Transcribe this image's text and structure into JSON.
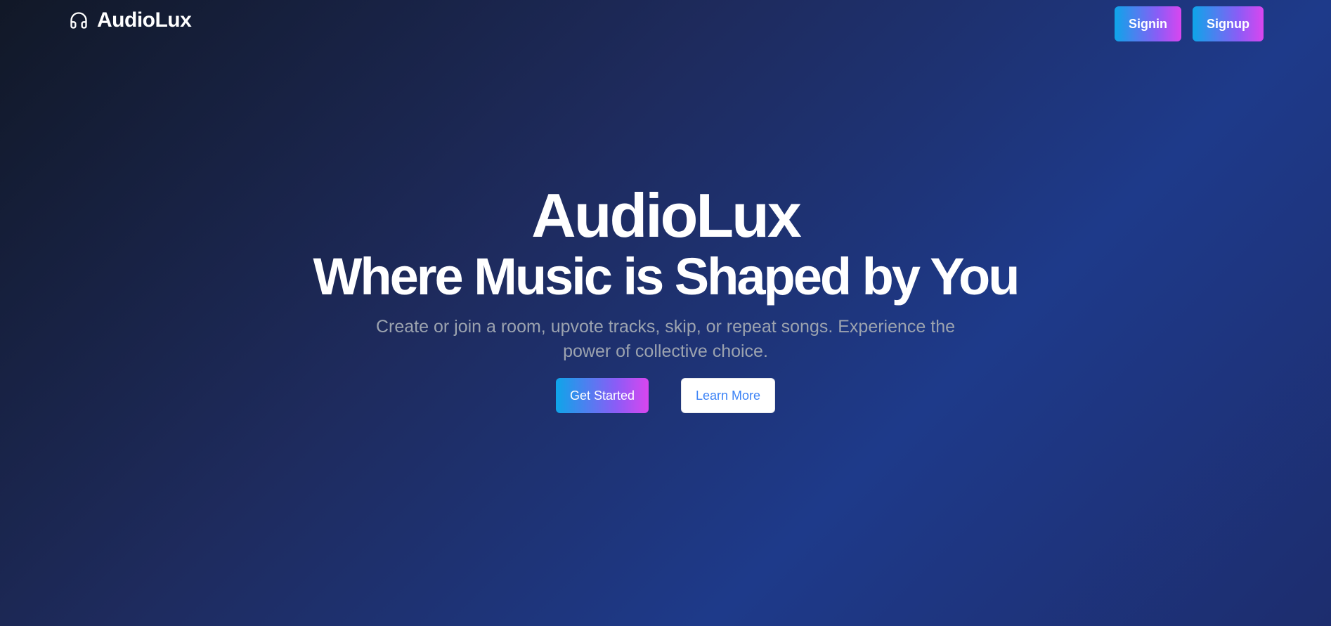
{
  "header": {
    "brand_icon": "headphones-icon",
    "brand_name": "AudioLux",
    "signin_label": "Signin",
    "signup_label": "Signup"
  },
  "hero": {
    "title": "AudioLux",
    "subtitle": "Where Music is Shaped by You",
    "description": "Create or join a room, upvote tracks, skip, or repeat songs. Experience the power of collective choice.",
    "get_started_label": "Get Started",
    "learn_more_label": "Learn More"
  },
  "colors": {
    "background_start": "#111827",
    "background_end": "#1e3a8a",
    "button_gradient_start": "#0ea5e9",
    "button_gradient_end": "#d946ef",
    "muted_text": "#9ca3af",
    "link_blue": "#3b82f6"
  }
}
